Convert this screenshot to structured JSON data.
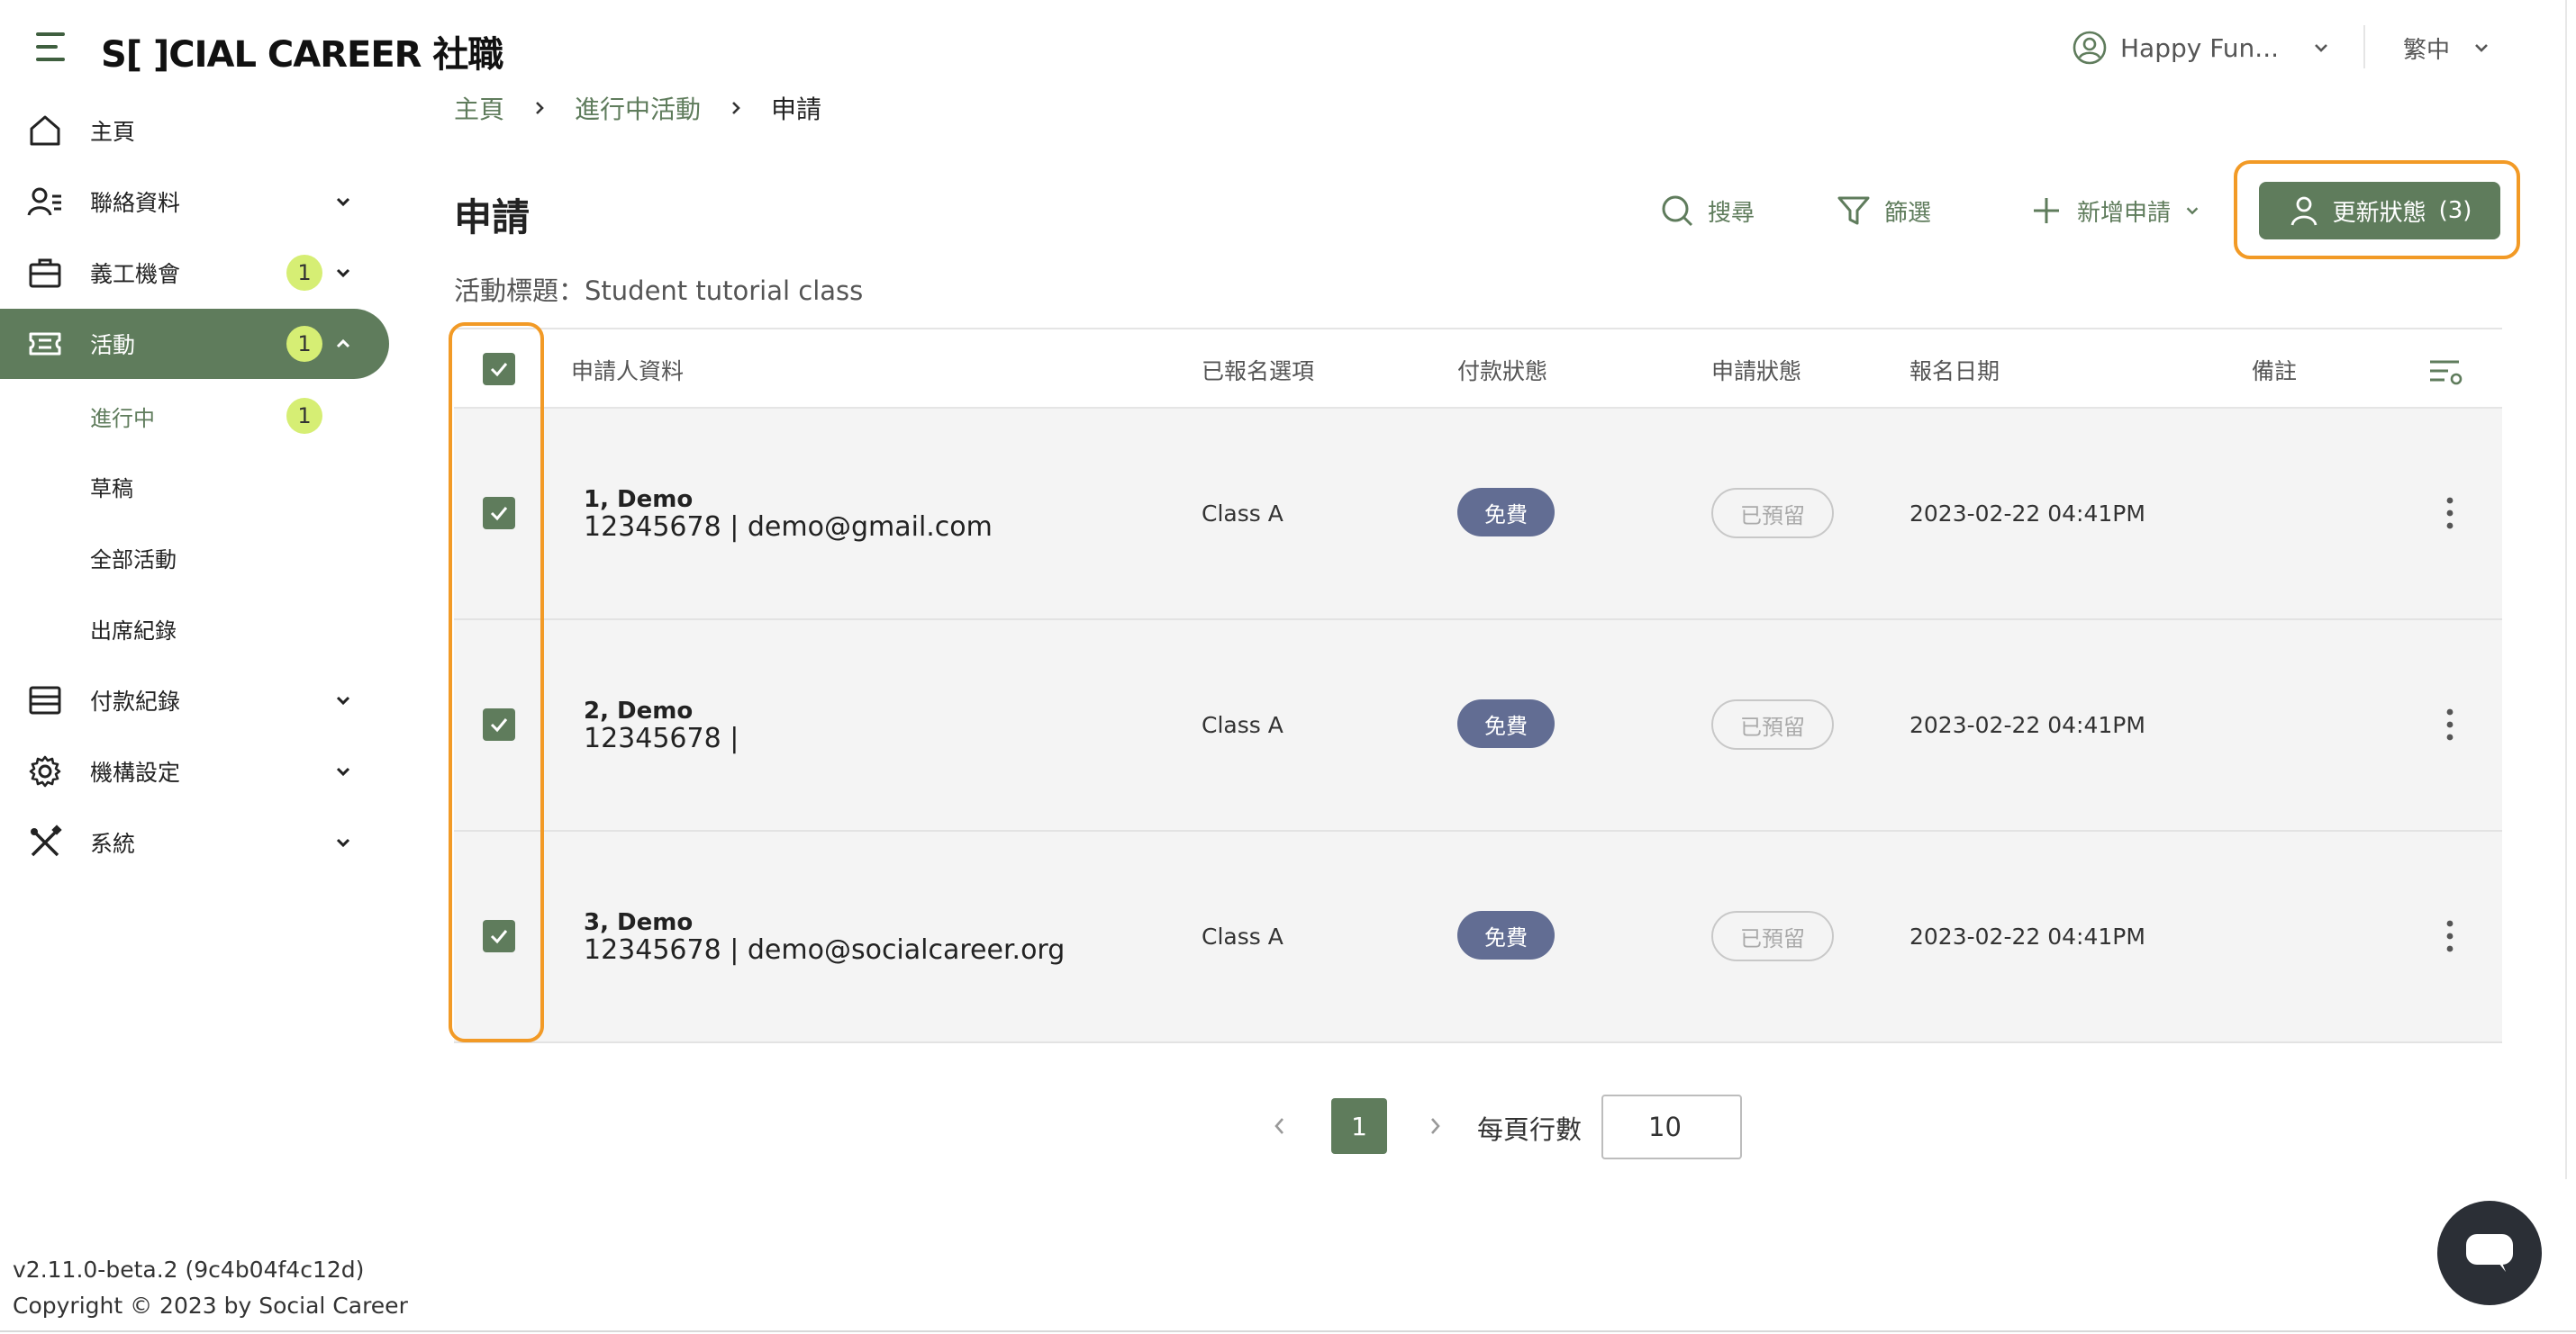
{
  "header": {
    "logo_text": "S[ ]CIAL CAREER 社職",
    "user_name": "Happy Fun...",
    "language": "繁中"
  },
  "sidebar": {
    "items": [
      {
        "label": "主頁",
        "icon": "home-icon"
      },
      {
        "label": "聯絡資料",
        "icon": "contacts-icon"
      },
      {
        "label": "義工機會",
        "icon": "briefcase-icon",
        "badge": "1"
      },
      {
        "label": "活動",
        "icon": "ticket-icon",
        "badge": "1"
      },
      {
        "label": "付款紀錄",
        "icon": "payment-icon"
      },
      {
        "label": "機構設定",
        "icon": "gear-icon"
      },
      {
        "label": "系統",
        "icon": "tools-icon"
      }
    ],
    "activity_sub": [
      {
        "label": "進行中",
        "badge": "1"
      },
      {
        "label": "草稿"
      },
      {
        "label": "全部活動"
      },
      {
        "label": "出席紀錄"
      }
    ],
    "version": "v2.11.0-beta.2 (9c4b04f4c12d)",
    "copyright": "Copyright © 2023 by Social Career"
  },
  "breadcrumb": [
    "主頁",
    "進行中活動",
    "申請"
  ],
  "page": {
    "title": "申請",
    "subtitle": "活動標題：Student tutorial class"
  },
  "toolbar": {
    "search": "搜尋",
    "filter": "篩選",
    "add": "新增申請",
    "update_status": "更新狀態",
    "update_count": "(3)"
  },
  "table": {
    "headers": {
      "applicant": "申請人資料",
      "option": "已報名選項",
      "payment": "付款狀態",
      "status": "申請狀態",
      "date": "報名日期",
      "remark": "備註"
    },
    "rows": [
      {
        "name": "1, Demo",
        "contact": "12345678 | demo@gmail.com",
        "option": "Class A",
        "payment": "免費",
        "status": "已預留",
        "date": "2023-02-22 04:41PM"
      },
      {
        "name": "2, Demo",
        "contact": "12345678 |",
        "option": "Class A",
        "payment": "免費",
        "status": "已預留",
        "date": "2023-02-22 04:41PM"
      },
      {
        "name": "3, Demo",
        "contact": "12345678 | demo@socialcareer.org",
        "option": "Class A",
        "payment": "免費",
        "status": "已預留",
        "date": "2023-02-22 04:41PM"
      }
    ]
  },
  "pagination": {
    "current_page": "1",
    "rows_per_page_label": "每頁行數",
    "rows_per_page": "10"
  },
  "colors": {
    "primary": "#5f7c5c",
    "badge": "#d6ee74",
    "pay_chip": "#626d93",
    "highlight": "#f29a26"
  }
}
